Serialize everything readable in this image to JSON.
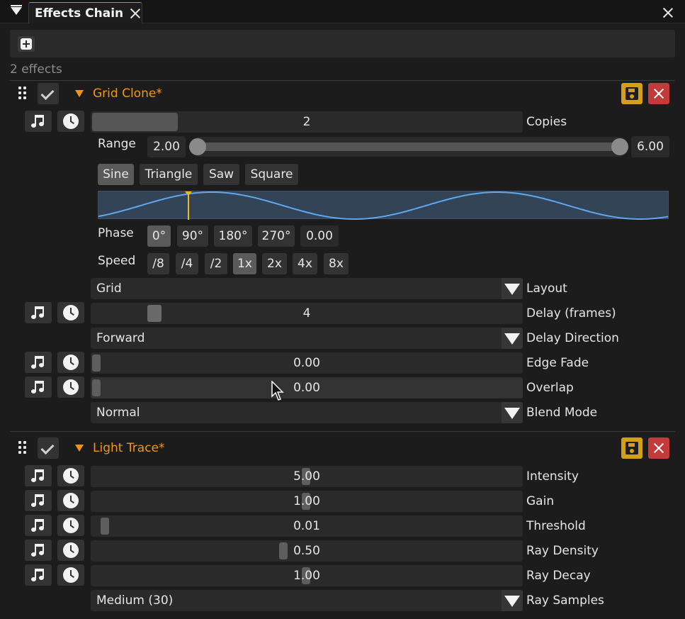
{
  "window": {
    "tab_title": "Effects Chain"
  },
  "toolbar": {
    "effect_count": "2 effects"
  },
  "effects": [
    {
      "name": "Grid Clone*",
      "copies": {
        "value": "2",
        "label": "Copies",
        "fraction": 0.2
      },
      "range": {
        "label": "Range",
        "min": "2.00",
        "max": "6.00",
        "low_fraction": 0.0,
        "high_fraction": 1.0
      },
      "waveforms": [
        "Sine",
        "Triangle",
        "Saw",
        "Square"
      ],
      "waveform_selected": "Sine",
      "phase": {
        "label": "Phase",
        "options": [
          "0°",
          "90°",
          "180°",
          "270°"
        ],
        "selected": "0°",
        "value": "0.00"
      },
      "speed": {
        "label": "Speed",
        "options": [
          "/8",
          "/4",
          "/2",
          "1x",
          "2x",
          "4x",
          "8x"
        ],
        "selected": "1x"
      },
      "layout": {
        "value": "Grid",
        "label": "Layout"
      },
      "delay": {
        "value": "4",
        "label": "Delay (frames)"
      },
      "delay_direction": {
        "value": "Forward",
        "label": "Delay Direction"
      },
      "edge_fade": {
        "value": "0.00",
        "label": "Edge Fade"
      },
      "overlap": {
        "value": "0.00",
        "label": "Overlap"
      },
      "blend_mode": {
        "value": "Normal",
        "label": "Blend Mode"
      }
    },
    {
      "name": "Light Trace*",
      "intensity": {
        "value": "5.00",
        "label": "Intensity"
      },
      "gain": {
        "value": "1.00",
        "label": "Gain"
      },
      "threshold": {
        "value": "0.01",
        "label": "Threshold"
      },
      "ray_density": {
        "value": "0.50",
        "label": "Ray Density"
      },
      "ray_decay": {
        "value": "1.00",
        "label": "Ray Decay"
      },
      "ray_samples": {
        "value": "Medium (30)",
        "label": "Ray Samples"
      }
    }
  ],
  "colors": {
    "accent_orange": "#f29611",
    "save_yellow": "#d4a017",
    "delete_red": "#c23a3a",
    "wave_line": "#5fa8f0",
    "phase_marker": "#f2b81a"
  },
  "icons": {
    "menu": "menu-triangle-icon",
    "close": "close-icon",
    "add": "plus-square-icon",
    "drag": "drag-handle-icon",
    "enable": "checkmark-icon",
    "collapse": "caret-down-icon",
    "save": "floppy-disk-icon",
    "delete": "x-icon",
    "audio": "music-note-icon",
    "tempo": "clock-icon"
  }
}
